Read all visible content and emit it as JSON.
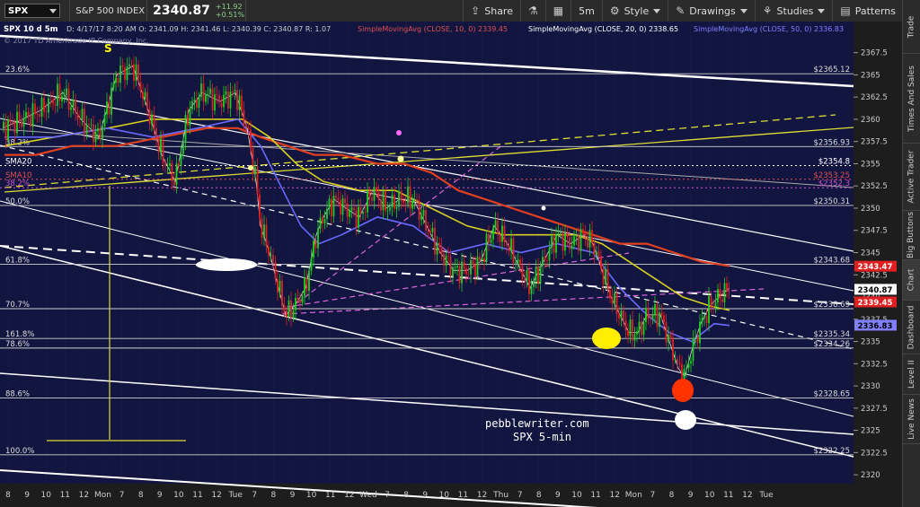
{
  "toolbar": {
    "symbol": "SPX",
    "name": "S&P 500 INDEX",
    "last": "2340.87",
    "change": "+11.92",
    "change_pct": "+0.51%",
    "share": "Share",
    "timeframe": "5m",
    "style": "Style",
    "drawings": "Drawings",
    "studies": "Studies",
    "patterns": "Patterns"
  },
  "side_tabs": [
    "Trade",
    "Times And Sales",
    "Active Trader",
    "Big Buttons",
    "Chart",
    "Dashboard",
    "Level II",
    "Live News"
  ],
  "chart_data": {
    "type": "candlestick",
    "header": {
      "info": "SPX 10 d 5m",
      "ohlc": "D: 4/17/17 8:20 AM  O: 2341.09  H: 2341.46  L: 2340.39  C: 2340.87  R: 1.07",
      "sma10": "SimpleMovingAvg (CLOSE, 10, 0) 2339.45",
      "sma20": "SimpleMovingAvg (CLOSE, 20, 0) 2338.65",
      "sma50": "SimpleMovingAvg (CLOSE, 50, 0) 2336.83"
    },
    "copyright": "© 2017 TD Ameritrade IP Company, Inc.",
    "ylim": [
      2319,
      2371
    ],
    "y_ticks": [
      2320,
      2322.5,
      2325,
      2327.5,
      2330,
      2332.5,
      2335,
      2337.5,
      2340,
      2342.5,
      2345,
      2347.5,
      2350,
      2352.5,
      2355,
      2357.5,
      2360,
      2362.5,
      2365,
      2367.5
    ],
    "x_labels": [
      "8",
      "9",
      "10",
      "11",
      "12",
      "Mon",
      "7",
      "8",
      "9",
      "10",
      "11",
      "12",
      "Tue",
      "7",
      "8",
      "9",
      "10",
      "11",
      "12",
      "Wed",
      "7",
      "8",
      "9",
      "10",
      "11",
      "12",
      "Thu",
      "7",
      "8",
      "9",
      "10",
      "11",
      "12",
      "Mon",
      "7",
      "8",
      "9",
      "10",
      "11",
      "12",
      "Tue"
    ],
    "fib_levels": [
      {
        "label": "23.6%",
        "value": 2365.12,
        "price": "$2365.12"
      },
      {
        "label": "38.2%",
        "value": 2356.93,
        "price": "$2356.93"
      },
      {
        "label": "50.0%",
        "value": 2350.31,
        "price": "$2350.31"
      },
      {
        "label": "61.8%",
        "value": 2343.68,
        "price": "$2343.68"
      },
      {
        "label": "70.7%",
        "value": 2338.69,
        "price": "$2338.69"
      },
      {
        "label": "161.8%",
        "value": 2335.34,
        "price": "$2335.34"
      },
      {
        "label": "78.6%",
        "value": 2334.26,
        "price": "$2334.26"
      },
      {
        "label": "88.6%",
        "value": 2328.65,
        "price": "$2328.65"
      },
      {
        "label": "100.0%",
        "value": 2322.25,
        "price": "$2322.25"
      }
    ],
    "sma_levels": [
      {
        "label": "SMA20",
        "value": 2354.8,
        "price": "$2354.8",
        "color": "#ffffff"
      },
      {
        "label": "SMA10",
        "value": 2353.25,
        "price": "$2353.25",
        "color": "#e05050"
      },
      {
        "label": "38.2%",
        "value": 2352.3,
        "price": "$2352.3",
        "color": "#cc55cc"
      }
    ],
    "price_badges": [
      {
        "value": 2343.47,
        "text": "2343.47",
        "bg": "#e02020",
        "fg": "#ffffff"
      },
      {
        "value": 2340.87,
        "text": "2340.87",
        "bg": "#ffffff",
        "fg": "#000000"
      },
      {
        "value": 2339.45,
        "text": "2339.45",
        "bg": "#e02020",
        "fg": "#ffffff"
      },
      {
        "value": 2336.83,
        "text": "2336.83",
        "bg": "#8080ff",
        "fg": "#000000"
      }
    ],
    "close_path": [
      [
        3,
        2359
      ],
      [
        25,
        2360
      ],
      [
        45,
        2361
      ],
      [
        70,
        2363
      ],
      [
        90,
        2360
      ],
      [
        110,
        2358
      ],
      [
        130,
        2365
      ],
      [
        148,
        2366
      ],
      [
        165,
        2361
      ],
      [
        180,
        2356
      ],
      [
        195,
        2353
      ],
      [
        210,
        2361
      ],
      [
        225,
        2363
      ],
      [
        245,
        2362
      ],
      [
        262,
        2363
      ],
      [
        275,
        2359
      ],
      [
        285,
        2353
      ],
      [
        290,
        2348
      ],
      [
        300,
        2345
      ],
      [
        310,
        2341
      ],
      [
        318,
        2338
      ],
      [
        328,
        2339
      ],
      [
        340,
        2341
      ],
      [
        352,
        2347
      ],
      [
        360,
        2349
      ],
      [
        372,
        2351
      ],
      [
        385,
        2350
      ],
      [
        400,
        2349
      ],
      [
        415,
        2352
      ],
      [
        430,
        2350
      ],
      [
        445,
        2351
      ],
      [
        460,
        2351
      ],
      [
        475,
        2348
      ],
      [
        490,
        2345
      ],
      [
        505,
        2343
      ],
      [
        520,
        2343
      ],
      [
        535,
        2344
      ],
      [
        550,
        2348
      ],
      [
        565,
        2346
      ],
      [
        580,
        2343
      ],
      [
        590,
        2341
      ],
      [
        600,
        2343
      ],
      [
        610,
        2345
      ],
      [
        620,
        2347
      ],
      [
        635,
        2346
      ],
      [
        650,
        2347
      ],
      [
        660,
        2346
      ],
      [
        670,
        2343
      ],
      [
        680,
        2340
      ],
      [
        690,
        2338
      ],
      [
        700,
        2336
      ],
      [
        710,
        2336
      ],
      [
        720,
        2338
      ],
      [
        735,
        2338
      ],
      [
        745,
        2335
      ],
      [
        755,
        2332
      ],
      [
        762,
        2331
      ],
      [
        770,
        2334
      ],
      [
        780,
        2337
      ],
      [
        790,
        2339
      ],
      [
        800,
        2340
      ],
      [
        812,
        2341
      ]
    ],
    "sma10_path": [
      [
        5,
        2356
      ],
      [
        40,
        2356
      ],
      [
        80,
        2357
      ],
      [
        130,
        2357
      ],
      [
        180,
        2358
      ],
      [
        230,
        2359
      ],
      [
        265,
        2359
      ],
      [
        290,
        2358
      ],
      [
        320,
        2357
      ],
      [
        350,
        2356
      ],
      [
        380,
        2356
      ],
      [
        420,
        2355
      ],
      [
        450,
        2355
      ],
      [
        480,
        2354
      ],
      [
        510,
        2352
      ],
      [
        540,
        2351
      ],
      [
        570,
        2350
      ],
      [
        600,
        2349
      ],
      [
        630,
        2348
      ],
      [
        660,
        2347
      ],
      [
        690,
        2346
      ],
      [
        720,
        2346
      ],
      [
        750,
        2345
      ],
      [
        780,
        2344
      ],
      [
        812,
        2343.5
      ]
    ],
    "sma20_path": [
      [
        5,
        2357
      ],
      [
        60,
        2358
      ],
      [
        120,
        2359
      ],
      [
        170,
        2360
      ],
      [
        230,
        2360
      ],
      [
        270,
        2360
      ],
      [
        300,
        2358
      ],
      [
        330,
        2355
      ],
      [
        360,
        2353
      ],
      [
        400,
        2352
      ],
      [
        440,
        2352
      ],
      [
        480,
        2350
      ],
      [
        520,
        2348
      ],
      [
        560,
        2347
      ],
      [
        600,
        2347
      ],
      [
        640,
        2347
      ],
      [
        670,
        2346
      ],
      [
        700,
        2344
      ],
      [
        730,
        2342
      ],
      [
        760,
        2340
      ],
      [
        790,
        2339
      ],
      [
        812,
        2338.5
      ]
    ],
    "sma50_path": [
      [
        5,
        2358
      ],
      [
        60,
        2358
      ],
      [
        120,
        2359
      ],
      [
        170,
        2358
      ],
      [
        220,
        2359
      ],
      [
        265,
        2360
      ],
      [
        290,
        2357
      ],
      [
        315,
        2352
      ],
      [
        335,
        2348
      ],
      [
        355,
        2346
      ],
      [
        380,
        2347
      ],
      [
        420,
        2349
      ],
      [
        460,
        2348
      ],
      [
        500,
        2345
      ],
      [
        540,
        2346
      ],
      [
        580,
        2345
      ],
      [
        620,
        2346
      ],
      [
        660,
        2345
      ],
      [
        690,
        2341
      ],
      [
        720,
        2338
      ],
      [
        745,
        2336
      ],
      [
        770,
        2335
      ],
      [
        795,
        2337
      ],
      [
        812,
        2336.8
      ]
    ],
    "annotations": {
      "watermark": "pebblewriter.com",
      "subtitle": "SPX 5-min",
      "s_marker": "S"
    }
  }
}
